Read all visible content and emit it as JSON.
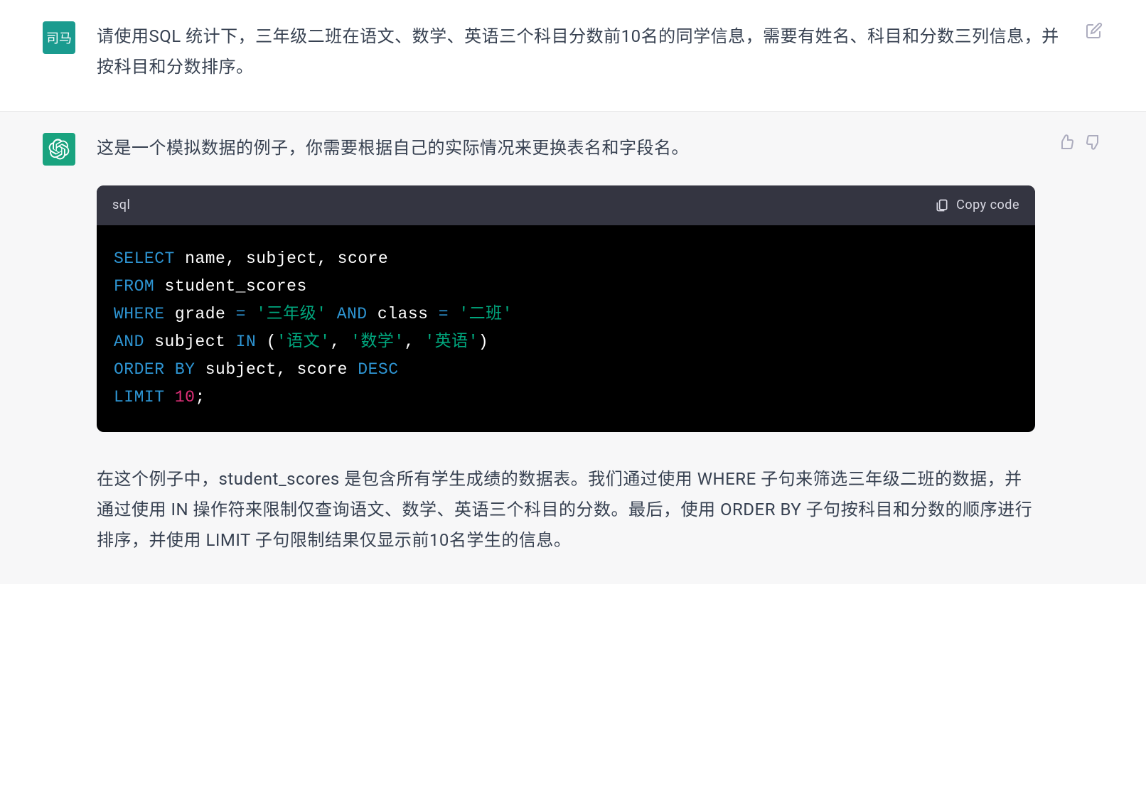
{
  "user": {
    "avatar_text": "司马",
    "message": "请使用SQL 统计下，三年级二班在语文、数学、英语三个科目分数前10名的同学信息，需要有姓名、科目和分数三列信息，并按科目和分数排序。"
  },
  "assistant": {
    "intro": "这是一个模拟数据的例子，你需要根据自己的实际情况来更换表名和字段名。",
    "code_lang": "sql",
    "copy_label": "Copy code",
    "code": {
      "l1_kw": "SELECT",
      "l1_rest": " name, subject, score",
      "l2_kw": "FROM",
      "l2_rest": " student_scores",
      "l3_kw": "WHERE",
      "l3_a": " grade ",
      "l3_eq1": "=",
      "l3_sp1": " ",
      "l3_str1": "'三年级'",
      "l3_sp2": " ",
      "l3_and": "AND",
      "l3_b": " class ",
      "l3_eq2": "=",
      "l3_sp3": " ",
      "l3_str2": "'二班'",
      "l4_and": "AND",
      "l4_a": " subject ",
      "l4_in": "IN",
      "l4_b": " (",
      "l4_s1": "'语文'",
      "l4_c1": ", ",
      "l4_s2": "'数学'",
      "l4_c2": ", ",
      "l4_s3": "'英语'",
      "l4_close": ")",
      "l5_kw1": "ORDER",
      "l5_sp": " ",
      "l5_kw2": "BY",
      "l5_rest": " subject, score ",
      "l5_desc": "DESC",
      "l6_kw": "LIMIT",
      "l6_sp": " ",
      "l6_num": "10",
      "l6_semi": ";"
    },
    "explain": "在这个例子中，student_scores 是包含所有学生成绩的数据表。我们通过使用 WHERE 子句来筛选三年级二班的数据，并通过使用 IN 操作符来限制仅查询语文、数学、英语三个科目的分数。最后，使用 ORDER BY 子句按科目和分数的顺序进行排序，并使用 LIMIT 子句限制结果仅显示前10名学生的信息。"
  }
}
